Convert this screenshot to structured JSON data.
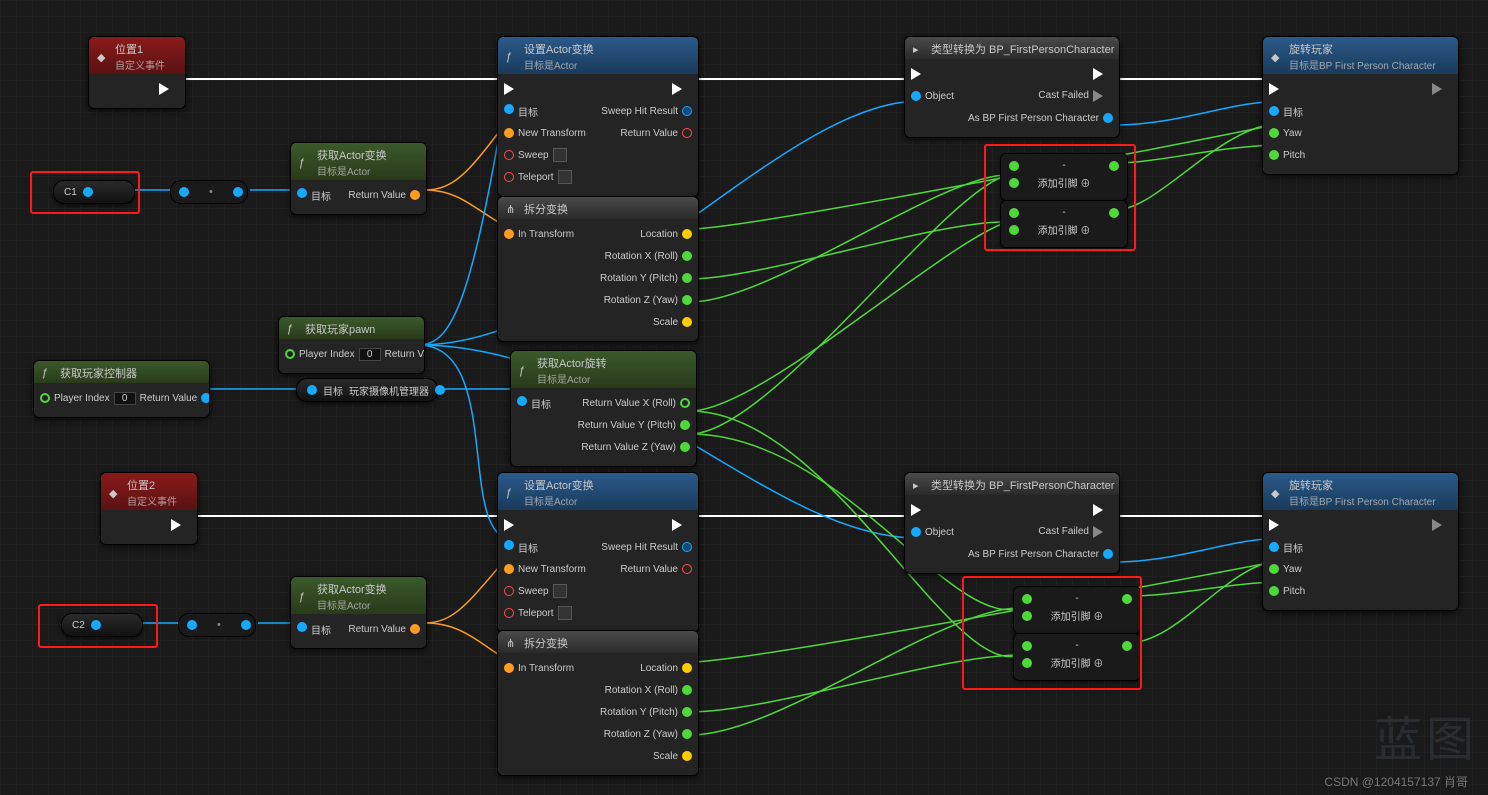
{
  "events": {
    "pos1": {
      "title": "位置1",
      "sub": "自定义事件"
    },
    "pos2": {
      "title": "位置2",
      "sub": "自定义事件"
    }
  },
  "setActor": {
    "title": "设置Actor变换",
    "sub": "目标是Actor",
    "pins": {
      "target": "目标",
      "newTransform": "New Transform",
      "sweep": "Sweep",
      "teleport": "Teleport",
      "sweepHit": "Sweep Hit Result",
      "returnVal": "Return Value"
    }
  },
  "getActorT": {
    "title": "获取Actor变换",
    "sub": "目标是Actor",
    "target": "目标",
    "ret": "Return Value"
  },
  "breakT": {
    "title": "拆分变换",
    "pins": {
      "inT": "In Transform",
      "loc": "Location",
      "rx": "Rotation X (Roll)",
      "ry": "Rotation Y (Pitch)",
      "rz": "Rotation Z (Yaw)",
      "scale": "Scale"
    }
  },
  "getPawn": {
    "title": "获取玩家pawn",
    "idx": "Player Index",
    "ret": "Return Value",
    "val": "0"
  },
  "getCtrl": {
    "title": "获取玩家控制器",
    "idx": "Player Index",
    "ret": "Return Value",
    "val": "0"
  },
  "camMgr": {
    "target": "目标",
    "label": "玩家摄像机管理器"
  },
  "getRot": {
    "title": "获取Actor旋转",
    "sub": "目标是Actor",
    "target": "目标",
    "rx": "Return Value X (Roll)",
    "ry": "Return Value Y (Pitch)",
    "rz": "Return Value Z (Yaw)"
  },
  "cast": {
    "title": "类型转换为 BP_FirstPersonCharacter",
    "obj": "Object",
    "fail": "Cast Failed",
    "as": "As BP First Person Character"
  },
  "rotPlayer": {
    "title": "旋转玩家",
    "sub": "目标是BP First Person Character",
    "target": "目标",
    "yaw": "Yaw",
    "pitch": "Pitch"
  },
  "vars": {
    "c1": "C1",
    "c2": "C2"
  },
  "addPin": "添加引脚",
  "dash": "-",
  "watermark": "CSDN @1204157137 肖哥",
  "wm2": "蓝图"
}
